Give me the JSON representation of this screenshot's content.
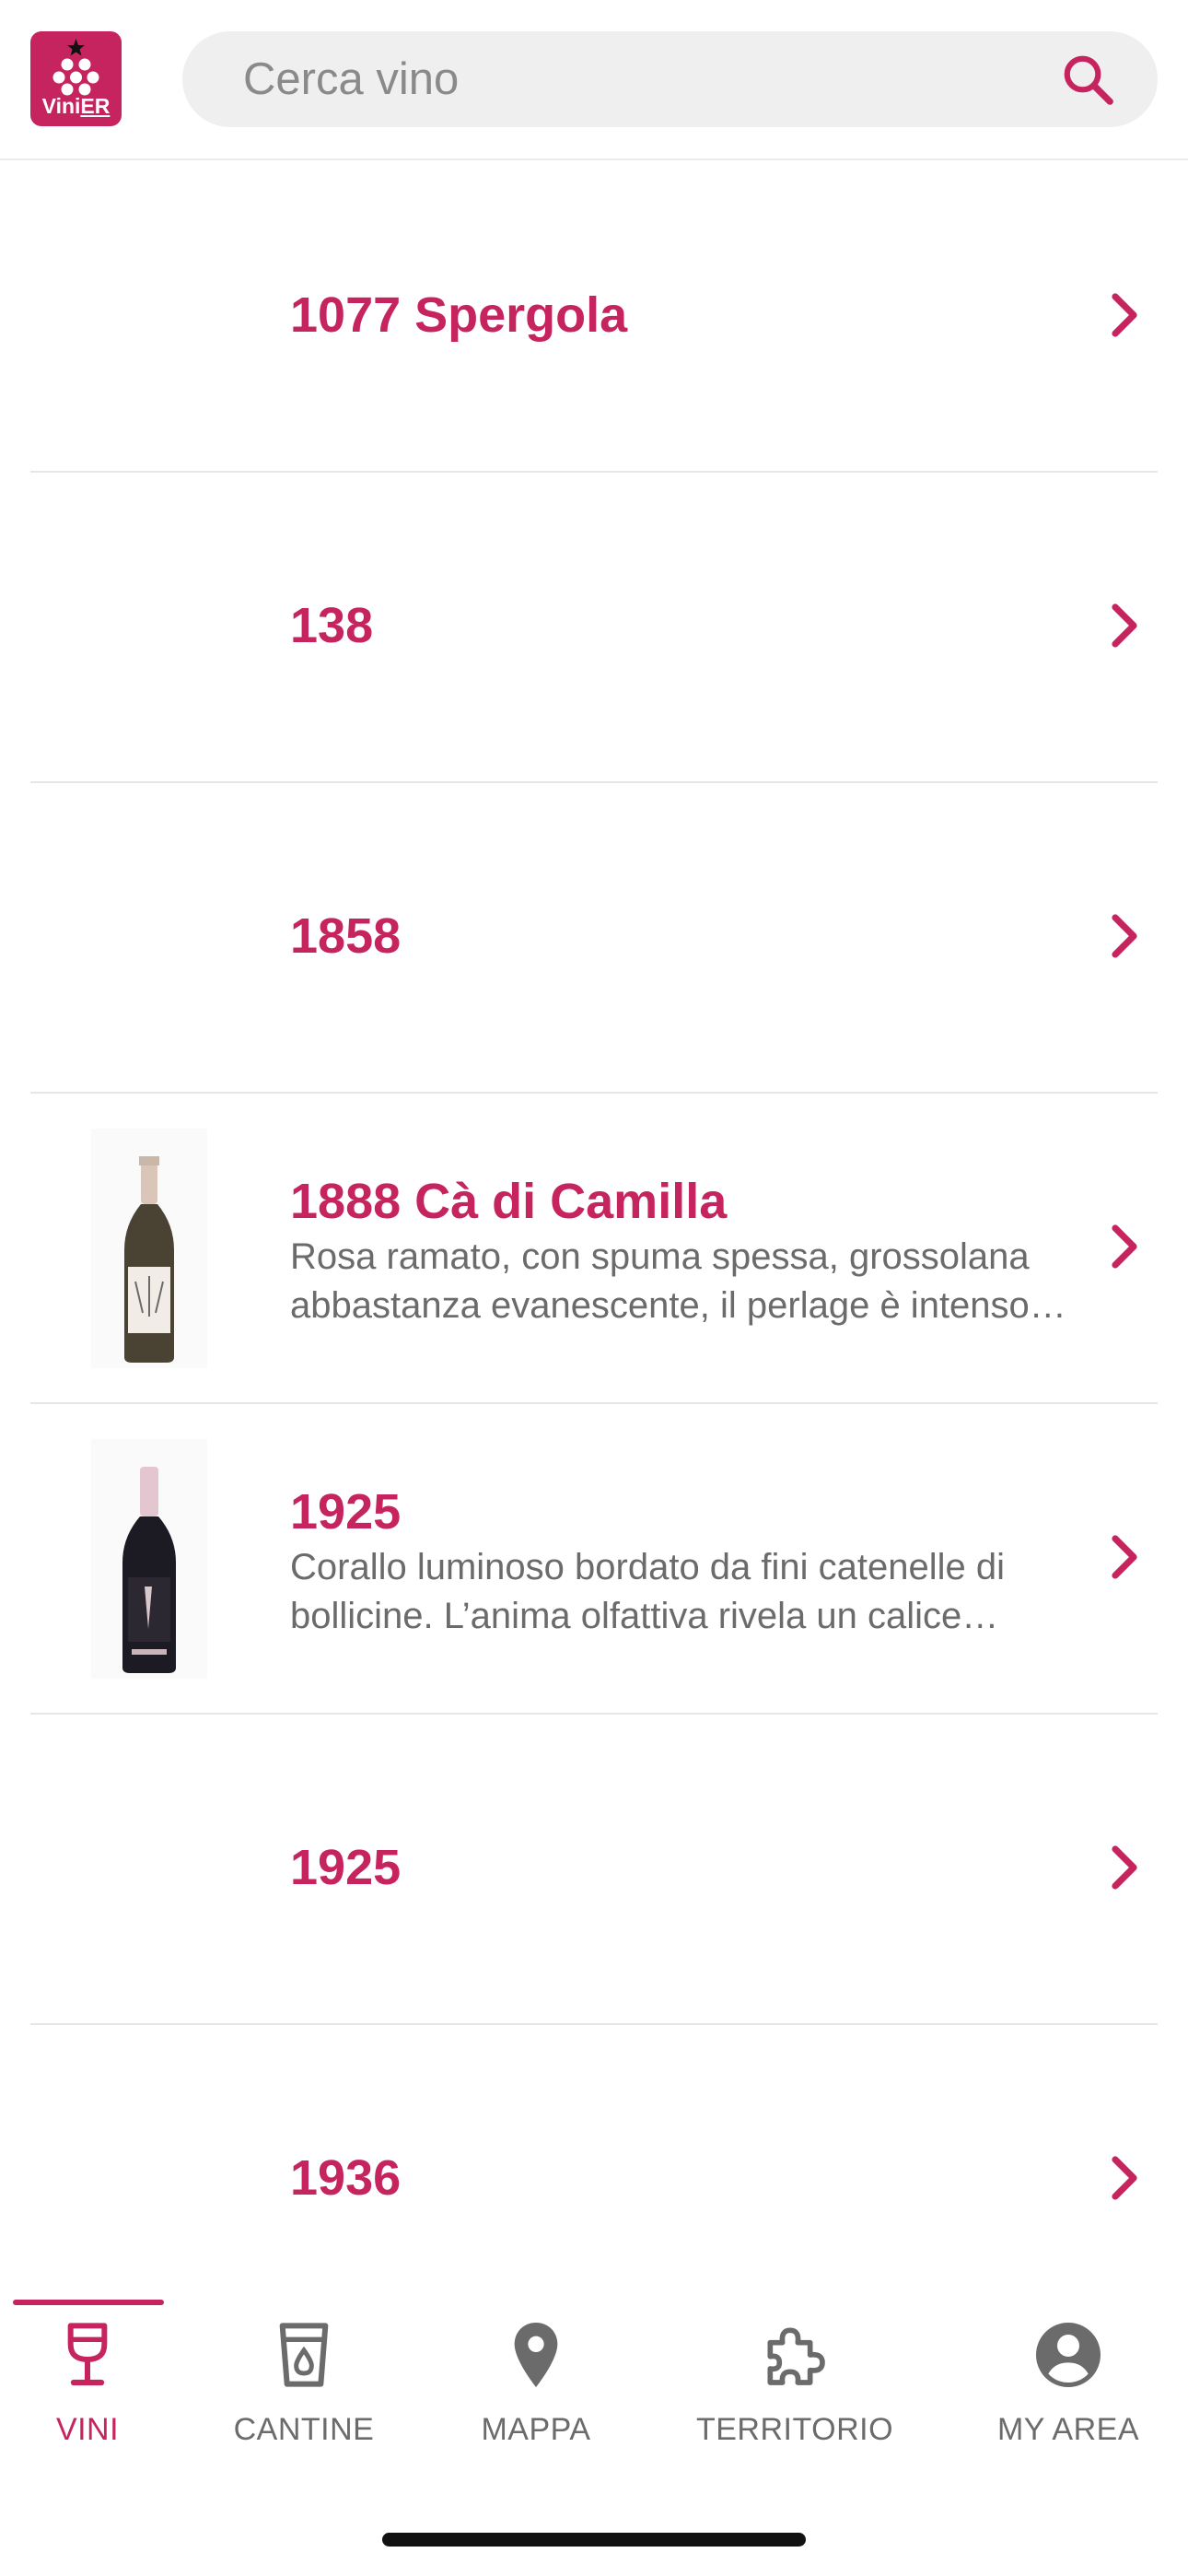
{
  "brand": {
    "logo_text_a": "Vini",
    "logo_text_b": "ER",
    "accent": "#c6245e"
  },
  "search": {
    "placeholder": "Cerca vino",
    "value": ""
  },
  "wines": [
    {
      "name": "1077 Spergola",
      "description": "",
      "has_image": false
    },
    {
      "name": "138",
      "description": "",
      "has_image": false
    },
    {
      "name": "1858",
      "description": "",
      "has_image": false
    },
    {
      "name": "1888 Cà di Camilla",
      "description": "Rosa ramato, con spuma spessa, grossolana abbastanza evanescente, il perlage è intenso…",
      "has_image": true,
      "bottle": "rose"
    },
    {
      "name": "1925",
      "description": "Corallo luminoso bordato da fini catenelle di bollicine. L’anima olfattiva rivela un calice inten…",
      "has_image": true,
      "bottle": "dark"
    },
    {
      "name": "1925",
      "description": "",
      "has_image": false
    },
    {
      "name": "1936",
      "description": "",
      "has_image": false
    }
  ],
  "tabs": [
    {
      "label": "VINI",
      "icon": "wine-glass-icon",
      "active": true
    },
    {
      "label": "CANTINE",
      "icon": "barrel-icon",
      "active": false
    },
    {
      "label": "MAPPA",
      "icon": "map-pin-icon",
      "active": false
    },
    {
      "label": "TERRITORIO",
      "icon": "puzzle-icon",
      "active": false
    },
    {
      "label": "MY AREA",
      "icon": "account-icon",
      "active": false
    }
  ]
}
